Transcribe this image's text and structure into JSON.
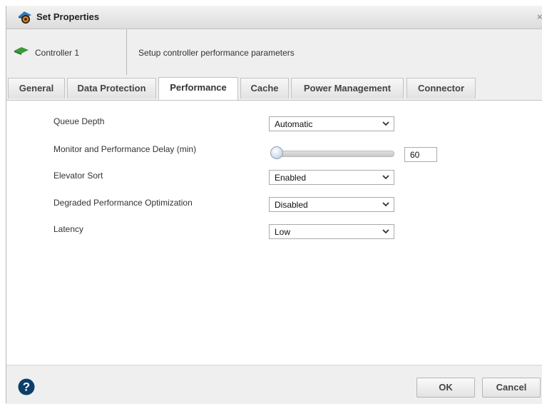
{
  "dialog": {
    "title": "Set Properties",
    "close_glyph": "×"
  },
  "header": {
    "controller_name": "Controller 1",
    "description": "Setup controller performance parameters"
  },
  "tabs": [
    {
      "label": "General",
      "active": false
    },
    {
      "label": "Data Protection",
      "active": false
    },
    {
      "label": "Performance",
      "active": true
    },
    {
      "label": "Cache",
      "active": false
    },
    {
      "label": "Power Management",
      "active": false
    },
    {
      "label": "Connector",
      "active": false
    }
  ],
  "settings": {
    "queue_depth": {
      "label": "Queue Depth",
      "value": "Automatic"
    },
    "monitor_delay": {
      "label": "Monitor and Performance Delay (min)",
      "value": "60",
      "slider_fraction": 0.0
    },
    "elevator_sort": {
      "label": "Elevator Sort",
      "value": "Enabled"
    },
    "degraded_opt": {
      "label": "Degraded Performance Optimization",
      "value": "Disabled"
    },
    "latency": {
      "label": "Latency",
      "value": "Low"
    }
  },
  "footer": {
    "ok_label": "OK",
    "cancel_label": "Cancel"
  },
  "icons": {
    "title": "gear-settings-icon",
    "controller": "controller-card-icon",
    "help": "help-icon",
    "dropdown": "chevron-down-icon"
  },
  "colors": {
    "help_icon": "#0c3e6a",
    "controller_icon": "#3a9a3a"
  }
}
